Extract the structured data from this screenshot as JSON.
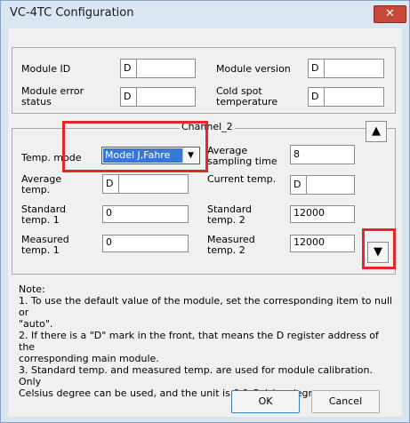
{
  "window": {
    "title": "VC-4TC Configuration",
    "close_glyph": "✕",
    "close_icon": "close-icon"
  },
  "module_info": {
    "module_id_label": "Module ID",
    "module_id_prefix": "D",
    "module_id_value": "",
    "module_version_label": "Module version",
    "module_version_prefix": "D",
    "module_version_value": "",
    "module_error_label_1": "Module error",
    "module_error_label_2": "status",
    "module_error_prefix": "D",
    "module_error_value": "",
    "cold_spot_label_1": "Cold spot",
    "cold_spot_label_2": "temperature",
    "cold_spot_prefix": "D",
    "cold_spot_value": ""
  },
  "channel": {
    "title": "Channel_2",
    "up_glyph": "▲",
    "up_icon": "arrow-up-icon",
    "down_glyph": "▼",
    "down_icon": "arrow-down-icon",
    "temp_mode_label": "Temp. mode",
    "temp_mode_value": "Model J,Fahre",
    "dropdown_glyph": "▼",
    "avg_sampling_label_1": "Average",
    "avg_sampling_label_2": "sampling time",
    "avg_sampling_value": "8",
    "avg_temp_label_1": "Average",
    "avg_temp_label_2": "temp.",
    "avg_temp_prefix": "D",
    "avg_temp_value": "",
    "current_temp_label": "Current temp.",
    "current_temp_prefix": "D",
    "current_temp_value": "",
    "std_temp1_label_1": "Standard",
    "std_temp1_label_2": "temp. 1",
    "std_temp1_value": "0",
    "std_temp2_label_1": "Standard",
    "std_temp2_label_2": "temp. 2",
    "std_temp2_value": "12000",
    "meas_temp1_label_1": "Measured",
    "meas_temp1_label_2": "temp. 1",
    "meas_temp1_value": "0",
    "meas_temp2_label_1": "Measured",
    "meas_temp2_label_2": "temp. 2",
    "meas_temp2_value": "12000"
  },
  "note": {
    "heading": "Note:",
    "line1a": "1. To use the default value of the module, set the corresponding item to null or",
    "line1b": "\"auto\".",
    "line2a": "2. If there is a \"D\" mark in the front, that means the D register address of the",
    "line2b": "corresponding main module.",
    "line3a": "3. Standard temp. and measured temp. are used for module calibration. Only",
    "line3b": "Celsius degree can be used, and the unit is 0.1 Celsius degree."
  },
  "buttons": {
    "ok": "OK",
    "cancel": "Cancel"
  },
  "colors": {
    "highlight_box": "#e8262a",
    "selection": "#3877d6",
    "close_button": "#c7483a"
  }
}
